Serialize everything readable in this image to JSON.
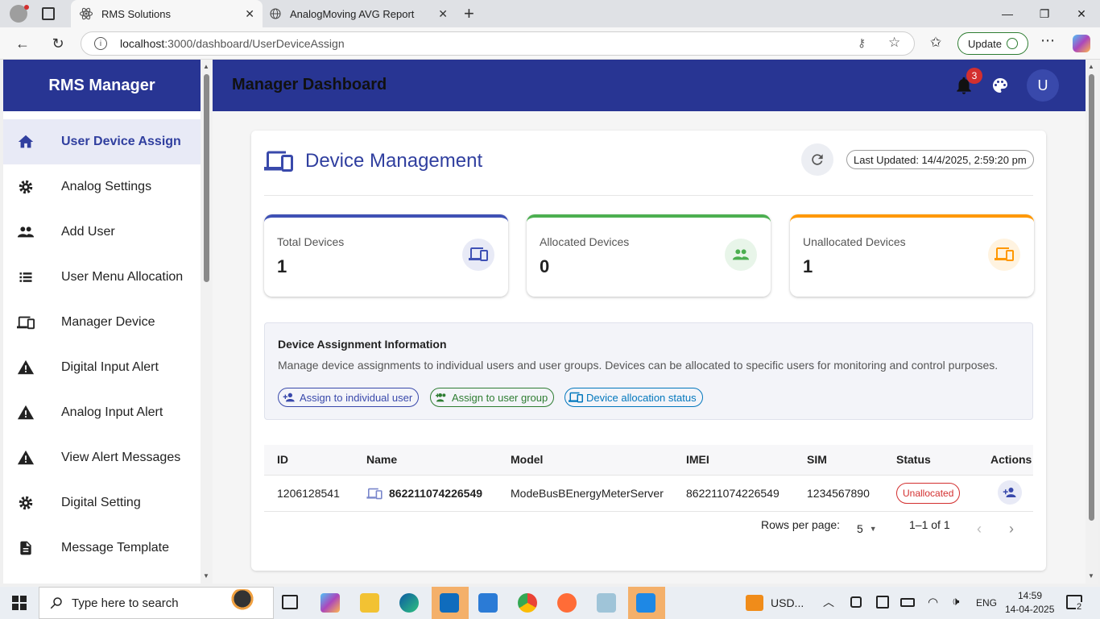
{
  "browser": {
    "tabs": [
      {
        "title": "RMS Solutions",
        "active": true
      },
      {
        "title": "AnalogMoving AVG Report",
        "active": false
      }
    ],
    "url_host": "localhost",
    "url_path": ":3000/dashboard/UserDeviceAssign",
    "update_label": "Update"
  },
  "sidebar": {
    "brand": "RMS Manager",
    "items": [
      {
        "label": "User Device Assign",
        "icon": "home-icon",
        "active": true
      },
      {
        "label": "Analog Settings",
        "icon": "gear-icon"
      },
      {
        "label": "Add User",
        "icon": "people-icon"
      },
      {
        "label": "User Menu Allocation",
        "icon": "list-icon"
      },
      {
        "label": "Manager Device",
        "icon": "devices-icon"
      },
      {
        "label": "Digital Input Alert",
        "icon": "warning-icon"
      },
      {
        "label": "Analog Input Alert",
        "icon": "warning-icon"
      },
      {
        "label": "View Alert Messages",
        "icon": "warning-icon"
      },
      {
        "label": "Digital Setting",
        "icon": "gear-icon"
      },
      {
        "label": "Message Template",
        "icon": "document-icon"
      }
    ]
  },
  "header": {
    "title": "Manager Dashboard",
    "notification_count": "3",
    "avatar_initial": "U"
  },
  "device_management": {
    "title": "Device Management",
    "last_updated": "Last Updated: 14/4/2025, 2:59:20 pm",
    "stats": [
      {
        "label": "Total Devices",
        "value": "1",
        "color": "#3f51b5"
      },
      {
        "label": "Allocated Devices",
        "value": "0",
        "color": "#4caf50"
      },
      {
        "label": "Unallocated Devices",
        "value": "1",
        "color": "#ff9800"
      }
    ],
    "info": {
      "title": "Device Assignment Information",
      "text": "Manage device assignments to individual users and user groups. Devices can be allocated to specific users for monitoring and control purposes.",
      "chips": [
        {
          "label": "Assign to individual user",
          "color": "#3949ab"
        },
        {
          "label": "Assign to user group",
          "color": "#2e7d32"
        },
        {
          "label": "Device allocation status",
          "color": "#0277bd"
        }
      ]
    },
    "table": {
      "columns": [
        "ID",
        "Name",
        "Model",
        "IMEI",
        "SIM",
        "Status",
        "Actions"
      ],
      "rows": [
        {
          "id": "1206128541",
          "name": "862211074226549",
          "model": "ModeBusBEnergyMeterServer",
          "imei": "862211074226549",
          "sim": "1234567890",
          "status": "Unallocated"
        }
      ],
      "rows_per_page_label": "Rows per page:",
      "rows_per_page": "5",
      "range": "1–1 of 1"
    }
  },
  "taskbar": {
    "search_placeholder": "Type here to search",
    "currency": "USD...",
    "lang": "ENG",
    "time": "14:59",
    "date": "14-04-2025",
    "notif_count": "2"
  }
}
